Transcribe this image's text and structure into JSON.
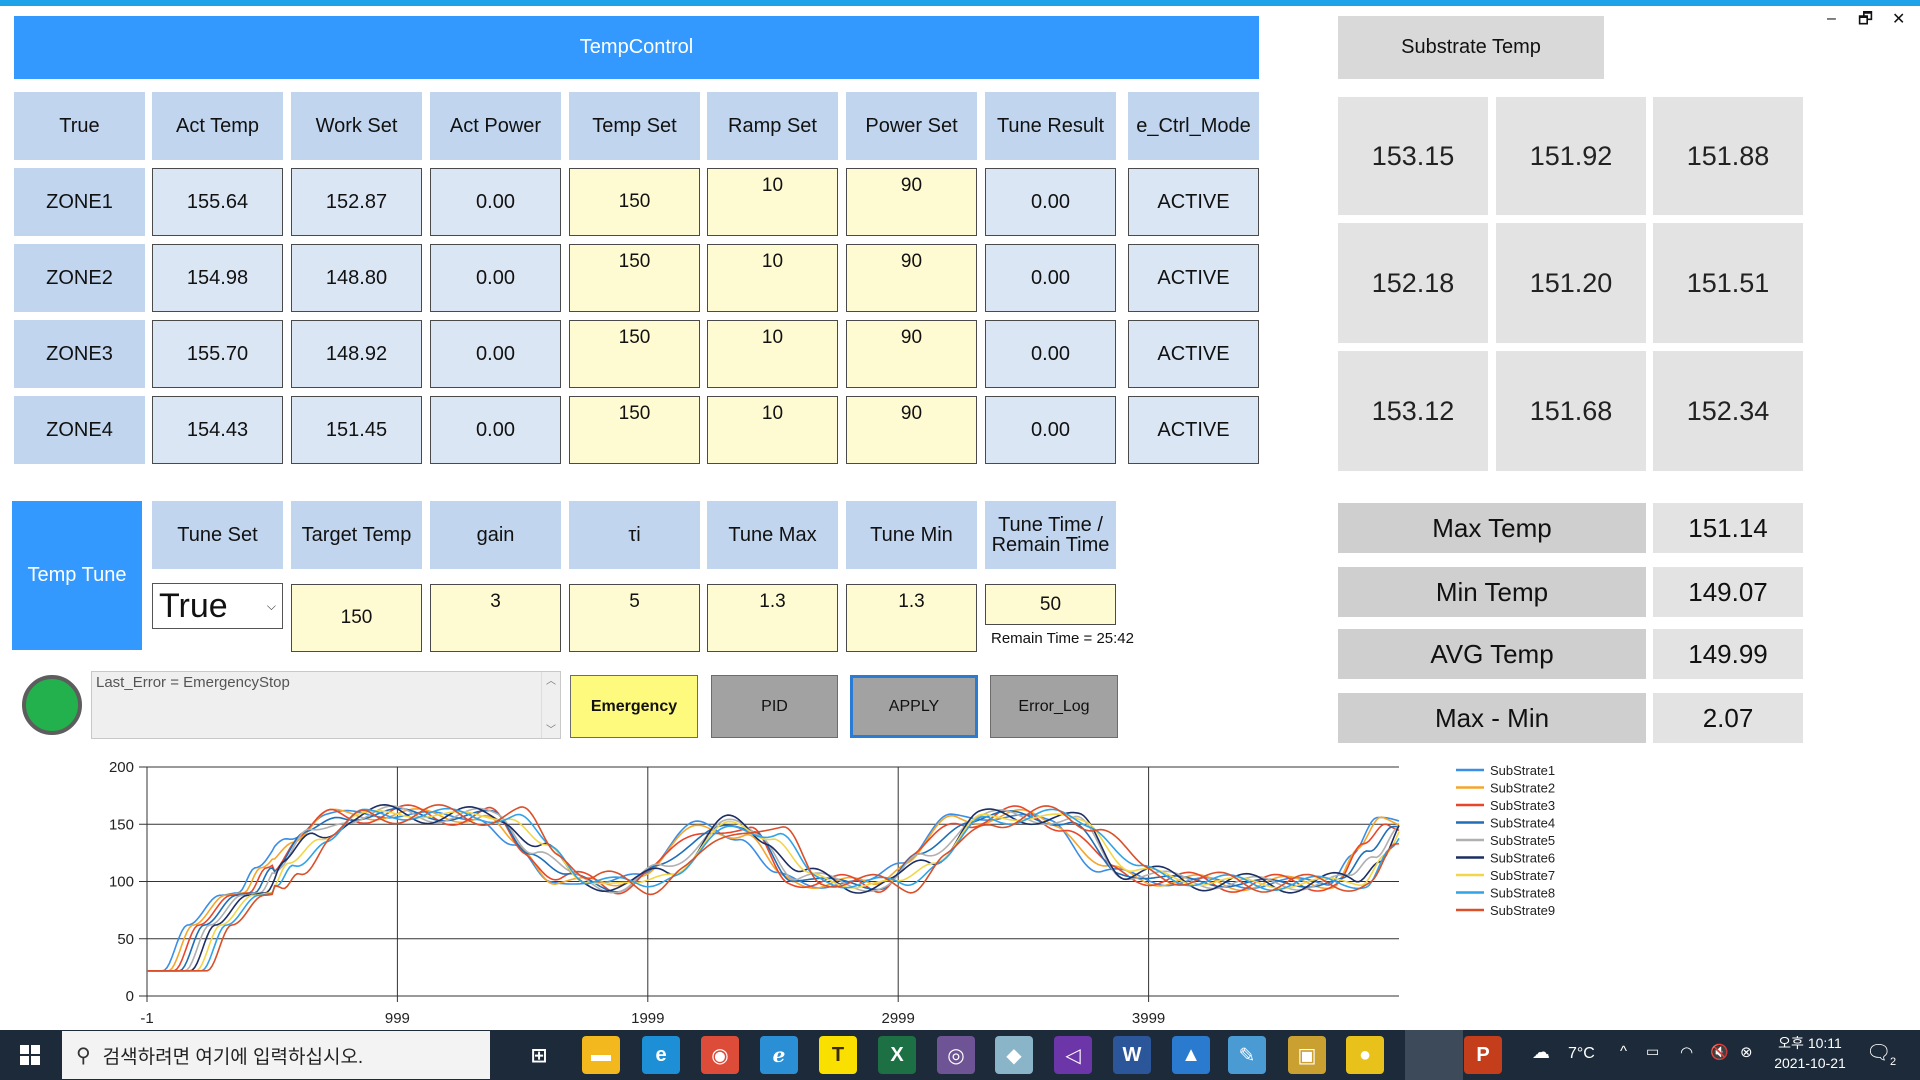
{
  "window": {
    "title": "TempControl",
    "minimize": "–",
    "restore": "🗗",
    "close": "✕"
  },
  "zones": {
    "headers": [
      "True",
      "Act Temp",
      "Work Set",
      "Act Power",
      "Temp Set",
      "Ramp Set",
      "Power Set",
      "Tune Result",
      "e_Ctrl_Mode"
    ],
    "rows": [
      {
        "name": "ZONE1",
        "act_temp": "155.64",
        "work_set": "152.87",
        "act_power": "0.00",
        "temp_set": "150",
        "ramp_set": "10",
        "power_set": "90",
        "tune_result": "0.00",
        "mode": "ACTIVE"
      },
      {
        "name": "ZONE2",
        "act_temp": "154.98",
        "work_set": "148.80",
        "act_power": "0.00",
        "temp_set": "150",
        "ramp_set": "10",
        "power_set": "90",
        "tune_result": "0.00",
        "mode": "ACTIVE"
      },
      {
        "name": "ZONE3",
        "act_temp": "155.70",
        "work_set": "148.92",
        "act_power": "0.00",
        "temp_set": "150",
        "ramp_set": "10",
        "power_set": "90",
        "tune_result": "0.00",
        "mode": "ACTIVE"
      },
      {
        "name": "ZONE4",
        "act_temp": "154.43",
        "work_set": "151.45",
        "act_power": "0.00",
        "temp_set": "150",
        "ramp_set": "10",
        "power_set": "90",
        "tune_result": "0.00",
        "mode": "ACTIVE"
      }
    ]
  },
  "tune": {
    "title": "Temp Tune",
    "headers": [
      "Tune Set",
      "Target Temp",
      "gain",
      "τi",
      "Tune Max",
      "Tune Min",
      "Tune Time /\nRemain Time"
    ],
    "tune_set": "True",
    "target_temp": "150",
    "gain": "3",
    "ti": "5",
    "tune_max": "1.3",
    "tune_min": "1.3",
    "tune_time": "50",
    "remain": "Remain Time = 25:42"
  },
  "error_box": {
    "text": "Last_Error = EmergencyStop"
  },
  "buttons": {
    "emergency": "Emergency",
    "pid": "PID",
    "apply": "APPLY",
    "error_log": "Error_Log"
  },
  "substrate": {
    "title": "Substrate Temp",
    "grid": [
      "153.15",
      "151.92",
      "151.88",
      "152.18",
      "151.20",
      "151.51",
      "153.12",
      "151.68",
      "152.34"
    ],
    "stats": [
      {
        "label": "Max Temp",
        "value": "151.14"
      },
      {
        "label": "Min Temp",
        "value": "149.07"
      },
      {
        "label": "AVG Temp",
        "value": "149.99"
      },
      {
        "label": "Max - Min",
        "value": "2.07"
      }
    ]
  },
  "chart_data": {
    "type": "line",
    "x_ticks": [
      "-1",
      "999",
      "1999",
      "2999",
      "3999"
    ],
    "y_ticks": [
      "200",
      "150",
      "100",
      "50",
      "0"
    ],
    "xlim": [
      -1,
      4999
    ],
    "ylim": [
      0,
      200
    ],
    "series": [
      {
        "name": "SubStrate1",
        "color": "#3a8ee6"
      },
      {
        "name": "SubStrate2",
        "color": "#f4a62a"
      },
      {
        "name": "SubStrate3",
        "color": "#e8462a"
      },
      {
        "name": "SubStrate4",
        "color": "#1f6fb8"
      },
      {
        "name": "SubStrate5",
        "color": "#b0b0b0"
      },
      {
        "name": "SubStrate6",
        "color": "#1c2e63"
      },
      {
        "name": "SubStrate7",
        "color": "#f2d64a"
      },
      {
        "name": "SubStrate8",
        "color": "#2fa3e6"
      },
      {
        "name": "SubStrate9",
        "color": "#d9502a"
      }
    ],
    "profile": [
      [
        -1,
        22
      ],
      [
        150,
        22
      ],
      [
        250,
        62
      ],
      [
        380,
        88
      ],
      [
        450,
        90
      ],
      [
        520,
        112
      ],
      [
        650,
        140
      ],
      [
        800,
        157
      ],
      [
        1000,
        160
      ],
      [
        1200,
        157
      ],
      [
        1400,
        158
      ],
      [
        1550,
        128
      ],
      [
        1700,
        103
      ],
      [
        1900,
        95
      ],
      [
        2050,
        110
      ],
      [
        2300,
        150
      ],
      [
        2450,
        140
      ],
      [
        2600,
        104
      ],
      [
        2800,
        98
      ],
      [
        2950,
        97
      ],
      [
        3100,
        120
      ],
      [
        3300,
        155
      ],
      [
        3500,
        158
      ],
      [
        3700,
        152
      ],
      [
        3900,
        108
      ],
      [
        4200,
        100
      ],
      [
        4500,
        98
      ],
      [
        4800,
        100
      ],
      [
        4900,
        125
      ],
      [
        4999,
        152
      ]
    ]
  },
  "taskbar": {
    "search_placeholder": "검색하려면 여기에 입력하십시오.",
    "weather": "7°C",
    "time": "오후 10:11",
    "date": "2021-10-21",
    "notification_count": "2"
  }
}
